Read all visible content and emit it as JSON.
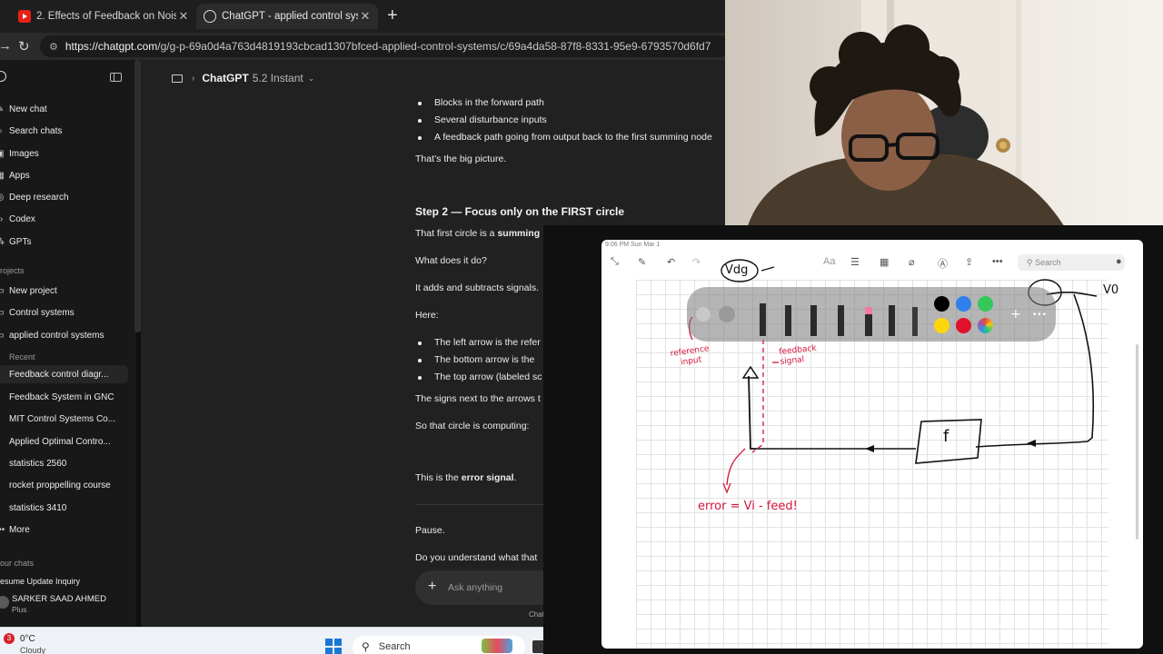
{
  "browser": {
    "tabs": [
      {
        "label": "2. Effects of Feedback on Noise an",
        "icon": "youtube-icon",
        "active": false
      },
      {
        "label": "ChatGPT - applied control systems",
        "icon": "chatgpt-icon",
        "active": true
      }
    ],
    "url_host": "https://chatgpt.com",
    "url_path": "/g/g-p-69a0d4a763d4819193cbcad1307bfced-applied-control-systems/c/69a4da58-87f8-8331-95e9-6793570d6fd7"
  },
  "sidebar": {
    "items": [
      {
        "label": "New chat",
        "icon": "new-chat-icon"
      },
      {
        "label": "Search chats",
        "icon": "search-icon"
      },
      {
        "label": "Images",
        "icon": "image-icon"
      },
      {
        "label": "Apps",
        "icon": "apps-icon"
      },
      {
        "label": "Deep research",
        "icon": "telescope-icon"
      },
      {
        "label": "Codex",
        "icon": "code-icon"
      },
      {
        "label": "GPTs",
        "icon": "gpts-icon"
      }
    ],
    "projects_title": "rojects",
    "projects": [
      {
        "label": "New project",
        "icon": "folder-plus-icon"
      },
      {
        "label": "Control systems",
        "icon": "folder-icon"
      },
      {
        "label": "applied control systems",
        "icon": "folder-icon"
      }
    ],
    "recent_title": "Recent",
    "recent": [
      "Feedback control diagr...",
      "Feedback System in GNC",
      "MIT Control Systems Co...",
      "Applied Optimal Contro...",
      "statistics 2560",
      "rocket proppelling course",
      "statistics 3410"
    ],
    "more_label": "More",
    "your_chats_title": "our chats",
    "partial_chat": "esume Update Inquiry",
    "user_name": "SARKER SAAD AHMED",
    "user_plan": "Plus"
  },
  "chat": {
    "model_name": "ChatGPT",
    "model_version": "5.2 Instant",
    "bullets_top": [
      "Blocks in the forward path",
      "Several disturbance inputs",
      "A feedback path going from output back to the first summing node"
    ],
    "big_picture": "That’s the big picture.",
    "step_heading": "Step 2 — Focus only on the FIRST circle",
    "summing_prefix": "That first circle is a ",
    "summing_bold": "summing",
    "what_does": "What does it do?",
    "adds": "It adds and subtracts signals.",
    "here": "Here:",
    "arrow_bullets": [
      "The left arrow is the refer",
      "The bottom arrow is the",
      "The top arrow (labeled sc"
    ],
    "signs_next": "The signs next to the arrows t",
    "circle_computing": "So that circle is computing:",
    "error_prefix": "This is the ",
    "error_bold": "error signal",
    "error_suffix": ".",
    "pause": "Pause.",
    "understand": "Do you understand what that",
    "composer_placeholder": "Ask anything",
    "footer": "Chat"
  },
  "taskbar": {
    "notification_count": "3",
    "weather_temp": "0°C",
    "weather_cond": "Cloudy",
    "search_label": "Search"
  },
  "notes": {
    "status_time": "9:06 PM",
    "status_date": "Sun Mar 1",
    "search_placeholder": "Search",
    "swatch_colors": [
      "#000000",
      "#2f80ed",
      "#34c759",
      "#ffd60a",
      "#e0112b",
      "#bb86fc"
    ],
    "handwriting": {
      "vdg": "Vdg",
      "v0": "V0",
      "f_block": "f",
      "reference_input": "reference input",
      "feedback_signal": "feedback signal",
      "error_eq": "error = Vi - feed!"
    }
  }
}
